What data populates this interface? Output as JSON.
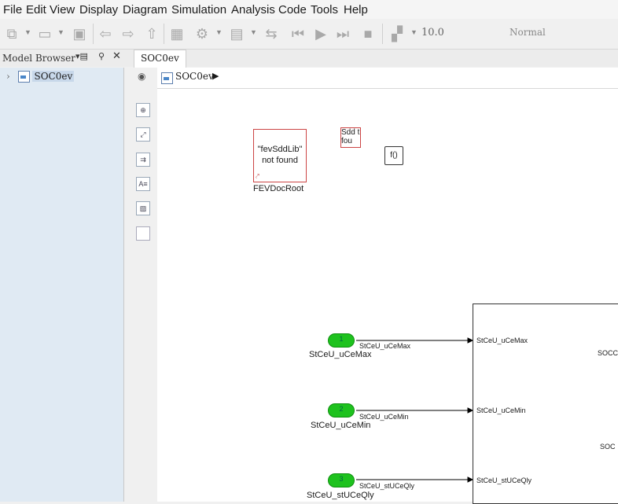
{
  "menu": [
    "File",
    "Edit",
    "View",
    "Display",
    "Diagram",
    "Simulation",
    "Analysis",
    "Code",
    "Tools",
    "Help"
  ],
  "toolbar": {
    "stop_time": "10.0",
    "sim_mode": "Normal"
  },
  "browser": {
    "title": "Model Browser",
    "tree_item": "SOC0ev"
  },
  "tabs": {
    "active": "SOC0ev"
  },
  "address": {
    "path": "SOC0ev"
  },
  "blocks": {
    "lib_block_text": "\"fevSddLib\" not found",
    "lib_block_name": "FEVDocRoot",
    "small_lib_text": "Sdd t fou",
    "func_label": "f()"
  },
  "ports": [
    {
      "num": "1",
      "name": "StCeU_uCeMax",
      "signal": "StCeU_uCeMax",
      "sub_input": "StCeU_uCeMax"
    },
    {
      "num": "2",
      "name": "StCeU_uCeMin",
      "signal": "StCeU_uCeMin",
      "sub_input": "StCeU_uCeMin"
    },
    {
      "num": "3",
      "name": "StCeU_stUCeQly",
      "signal": "StCeU_stUCeQly",
      "sub_input": "StCeU_stUCeQly"
    }
  ],
  "subsystem": {
    "out1": "SOCC",
    "out2": "SOC"
  },
  "colors": {
    "inport_fill": "#1ec21e",
    "browser_bg": "#e0eaf3",
    "error_border": "#cc4444"
  }
}
